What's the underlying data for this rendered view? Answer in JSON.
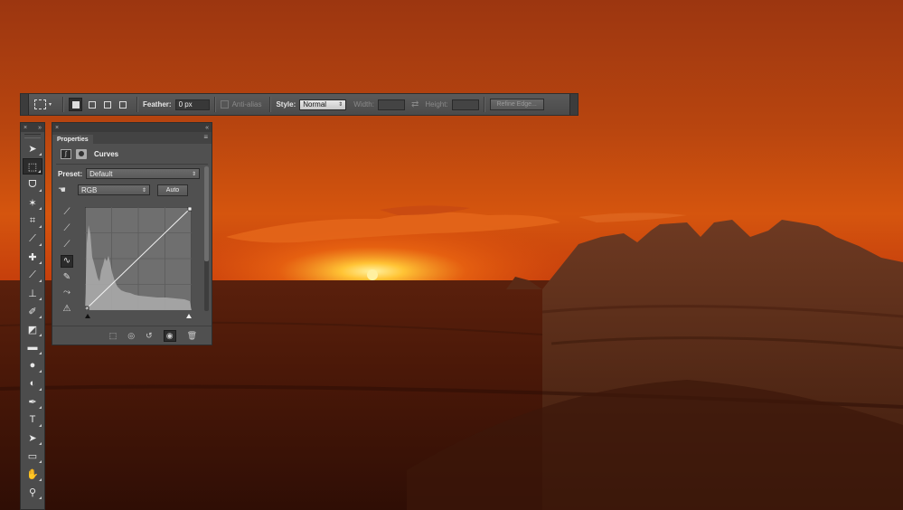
{
  "options_bar": {
    "feather_label": "Feather:",
    "feather_value": "0 px",
    "anti_alias_label": "Anti-alias",
    "style_label": "Style:",
    "style_value": "Normal",
    "width_label": "Width:",
    "height_label": "Height:",
    "refine_edge_label": "Refine Edge..."
  },
  "tools": [
    {
      "name": "move-tool-icon",
      "glyph": "➤"
    },
    {
      "name": "rectangular-marquee-tool-icon",
      "glyph": "⬚",
      "active": true
    },
    {
      "name": "lasso-tool-icon",
      "glyph": "ᗜ"
    },
    {
      "name": "magic-wand-tool-icon",
      "glyph": "✶"
    },
    {
      "name": "crop-tool-icon",
      "glyph": "⌗"
    },
    {
      "name": "eyedropper-tool-icon",
      "glyph": "⟋"
    },
    {
      "name": "healing-brush-tool-icon",
      "glyph": "✚"
    },
    {
      "name": "brush-tool-icon",
      "glyph": "⟋"
    },
    {
      "name": "clone-stamp-tool-icon",
      "glyph": "⊥"
    },
    {
      "name": "history-brush-tool-icon",
      "glyph": "✐"
    },
    {
      "name": "eraser-tool-icon",
      "glyph": "◩"
    },
    {
      "name": "gradient-tool-icon",
      "glyph": "▬"
    },
    {
      "name": "blur-tool-icon",
      "glyph": "●"
    },
    {
      "name": "dodge-tool-icon",
      "glyph": "◐"
    },
    {
      "name": "pen-tool-icon",
      "glyph": "✒"
    },
    {
      "name": "type-tool-icon",
      "glyph": "T"
    },
    {
      "name": "path-selection-tool-icon",
      "glyph": "➤"
    },
    {
      "name": "rectangle-shape-tool-icon",
      "glyph": "▭"
    },
    {
      "name": "hand-tool-icon",
      "glyph": "✋"
    },
    {
      "name": "zoom-tool-icon",
      "glyph": "⚲"
    }
  ],
  "properties": {
    "tab_label": "Properties",
    "adjustment_name": "Curves",
    "preset_label": "Preset:",
    "preset_value": "Default",
    "channel_value": "RGB",
    "auto_label": "Auto"
  },
  "colors": {
    "panel_bg": "#505050",
    "sky_top": "#a23a10",
    "sun": "#ffd24a"
  }
}
